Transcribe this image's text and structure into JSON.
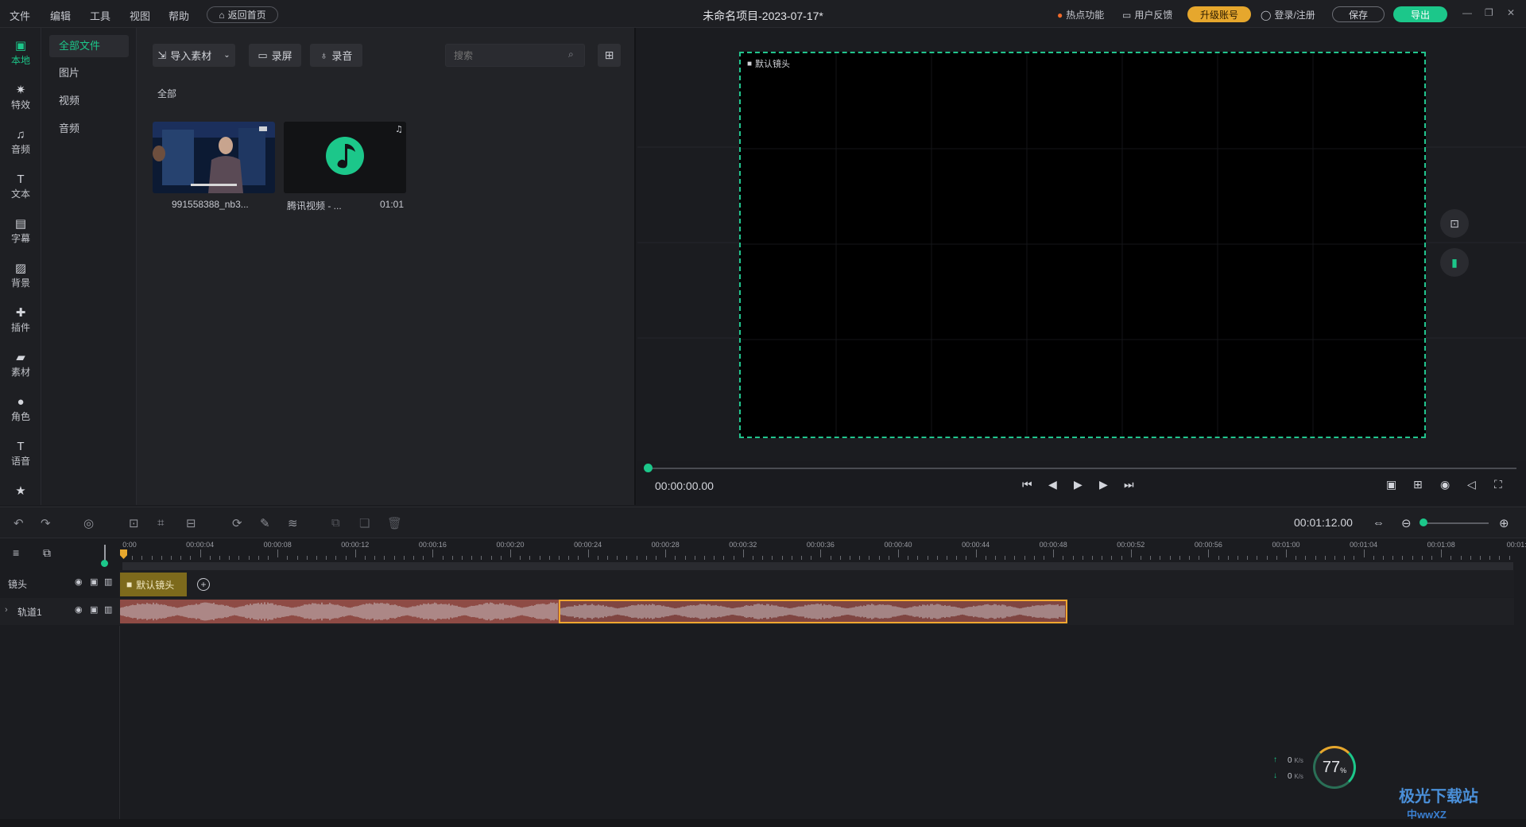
{
  "menubar": {
    "menus": [
      "文件",
      "编辑",
      "工具",
      "视图",
      "帮助"
    ],
    "home_label": "返回首页",
    "project_title": "未命名项目-2023-07-17*",
    "hot": "热点功能",
    "feedback": "用户反馈",
    "upgrade": "升级账号",
    "login": "登录/注册",
    "save": "保存",
    "export": "导出"
  },
  "iconbar": {
    "items": [
      {
        "label": "本地",
        "icon": "local-icon"
      },
      {
        "label": "特效",
        "icon": "effects-icon"
      },
      {
        "label": "音频",
        "icon": "audio-icon"
      },
      {
        "label": "文本",
        "icon": "text-icon"
      },
      {
        "label": "字幕",
        "icon": "subtitle-icon"
      },
      {
        "label": "背景",
        "icon": "background-icon"
      },
      {
        "label": "插件",
        "icon": "plugin-icon"
      },
      {
        "label": "素材",
        "icon": "material-icon"
      },
      {
        "label": "角色",
        "icon": "character-icon"
      },
      {
        "label": "语音",
        "icon": "voice-icon"
      }
    ]
  },
  "categories": [
    "全部文件",
    "图片",
    "视频",
    "音频"
  ],
  "media": {
    "import_label": "导入素材",
    "record_screen": "录屏",
    "record_audio": "录音",
    "search_placeholder": "搜索",
    "section": "全部",
    "items": [
      {
        "caption": "991558388_nb3...",
        "duration": ""
      },
      {
        "caption": "腾讯视频 - ...",
        "duration": "01:01"
      }
    ]
  },
  "preview": {
    "stage_label": "默认镜头",
    "timecode": "00:00:00.00"
  },
  "timeline": {
    "duration": "00:01:12.00",
    "ticks": [
      "0:00",
      "00:00:04",
      "00:00:08",
      "00:00:12",
      "00:00:16",
      "00:00:20",
      "00:00:24",
      "00:00:28",
      "00:00:32",
      "00:00:36",
      "00:00:40",
      "00:00:44",
      "00:00:48",
      "00:00:52",
      "00:00:56",
      "00:01:00",
      "00:01:04",
      "00:01:08",
      "00:01:1"
    ],
    "tracks": [
      {
        "name": "镜头"
      },
      {
        "name": "轨道1"
      }
    ],
    "camera_clip": "默认镜头"
  },
  "speed": {
    "up": "0",
    "down": "0",
    "unit": "K/s",
    "percent": "77",
    "percent_sign": "%"
  },
  "watermark": {
    "line1": "极光下载站",
    "line2": "中wwXZ"
  },
  "colors": {
    "accent": "#1cc78a",
    "upgrade": "#e6a72d",
    "audio_clip": "#8e4b45",
    "camera_clip": "#7d6a1c"
  }
}
